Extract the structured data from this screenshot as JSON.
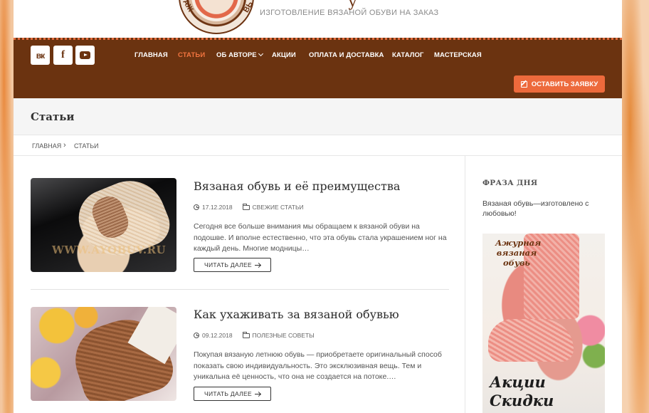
{
  "header": {
    "logo_left": "АЖ",
    "logo_right": "ВЬ",
    "brand_partial": "у",
    "tagline": "ИЗГОТОВЛЕНИЕ ВЯЗАНОЙ ОБУВИ НА ЗАКАЗ"
  },
  "social": [
    {
      "label": "вк",
      "icon": "vk-icon"
    },
    {
      "label": "f",
      "icon": "facebook-icon"
    },
    {
      "label": "",
      "icon": "youtube-icon"
    }
  ],
  "nav": {
    "items": [
      {
        "label": "ГЛАВНАЯ",
        "active": false
      },
      {
        "label": "СТАТЬИ",
        "active": true
      },
      {
        "label": "ОБ АВТОРЕ",
        "active": false,
        "has_dropdown": true
      },
      {
        "label": "АКЦИИ",
        "active": false
      },
      {
        "label": "ОПЛАТА И ДОСТАВКА",
        "active": false
      },
      {
        "label": "КАТАЛОГ",
        "active": false
      },
      {
        "label": "МАСТЕРСКАЯ",
        "active": false
      }
    ],
    "cta_label": "ОСТАВИТЬ ЗАЯВКУ"
  },
  "page": {
    "title": "Статьи"
  },
  "breadcrumb": {
    "items": [
      "ГЛАВНАЯ",
      "СТАТЬИ"
    ],
    "separator": "›"
  },
  "posts": [
    {
      "title": "Вязаная обувь и её преимущества",
      "date": "17.12.2018",
      "category": "СВЕЖИЕ СТАТЬИ",
      "excerpt": "Сегодня все больше внимания мы обращаем к вязаной обуви на подошве. И вполне естественно, что эта обувь стала украшением ног на каждый день. Многие модницы…",
      "read_more": "ЧИТАТЬ ДАЛЕЕ",
      "image_watermark": "WWW.AYOBUV.RU"
    },
    {
      "title": "Как ухаживать за вязаной обувью",
      "date": "09.12.2018",
      "category": "ПОЛЕЗНЫЕ СОВЕТЫ",
      "excerpt": "Покупая вязаную летнюю обувь — приобретаете оригинальный способ показать свою индивидуальность. Это эксклюзивная вещь. Тем и уникальна её ценность, что она не создается на потоке.…",
      "read_more": "ЧИТАТЬ ДАЛЕЕ"
    }
  ],
  "sidebar": {
    "widget_title": "ФРАЗА ДНЯ",
    "widget_text": "Вязаная обувь—изготовлено с любовью!",
    "banner_top": "Ажурная вязаная обувь",
    "banner_bottom": "Акции Скидки"
  },
  "colors": {
    "nav_bg": "#6b3310",
    "accent": "#ed6a3c",
    "active_nav": "#f1743f"
  }
}
